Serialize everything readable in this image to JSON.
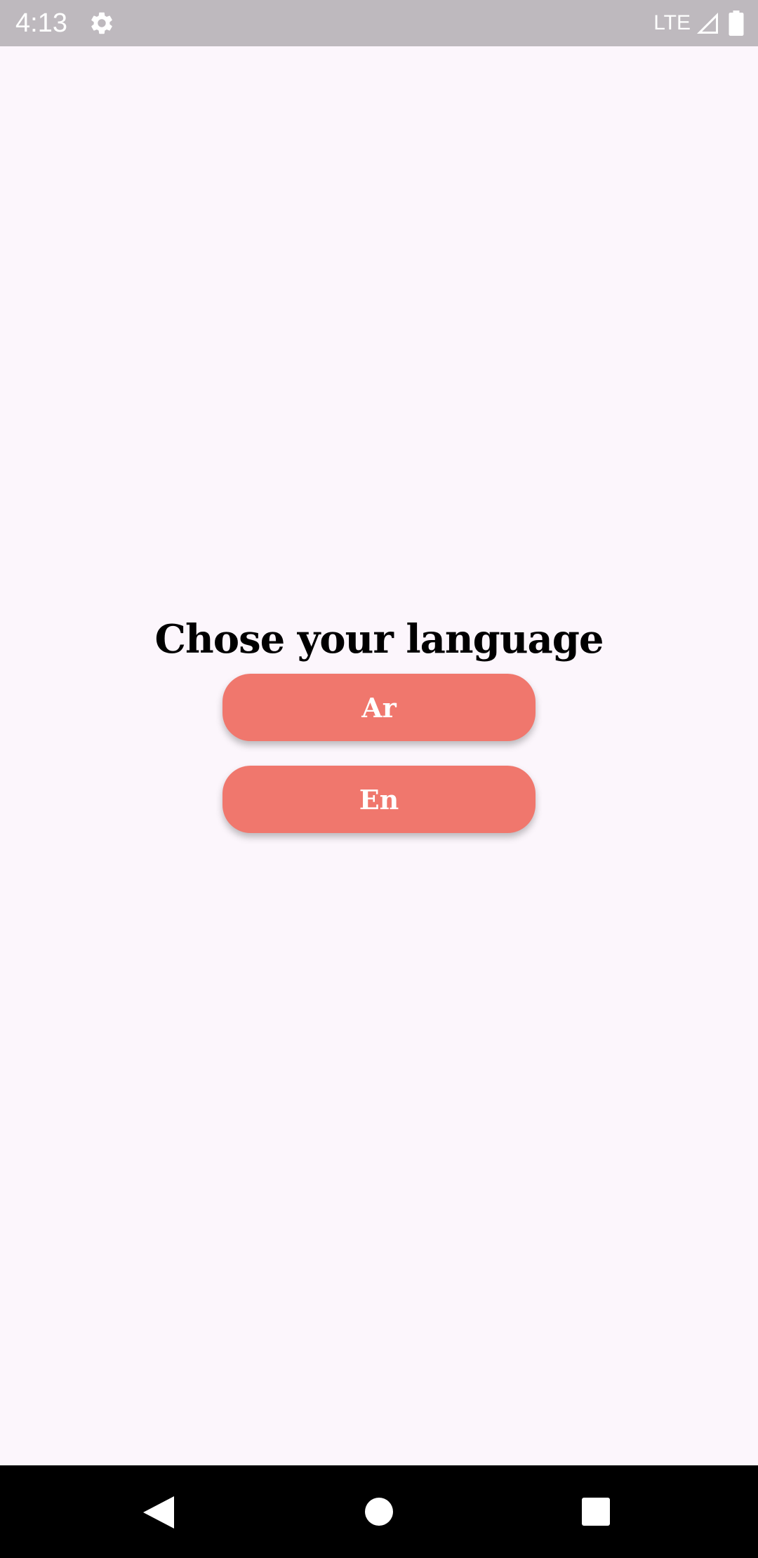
{
  "status_bar": {
    "time": "4:13",
    "network": "LTE",
    "icons": [
      "gear-icon",
      "signal-icon",
      "battery-icon"
    ]
  },
  "screen": {
    "title": "Chose your language",
    "buttons": [
      {
        "label": "Ar"
      },
      {
        "label": "En"
      }
    ]
  },
  "nav_bar": {
    "icons": [
      "back-icon",
      "home-icon",
      "recents-icon"
    ]
  },
  "colors": {
    "background": "#FCF6FC",
    "status_bar": "#BEB9BE",
    "button": "#F0776D",
    "button_text": "#FFFFFF",
    "title_text": "#000000",
    "nav_bar": "#000000"
  }
}
